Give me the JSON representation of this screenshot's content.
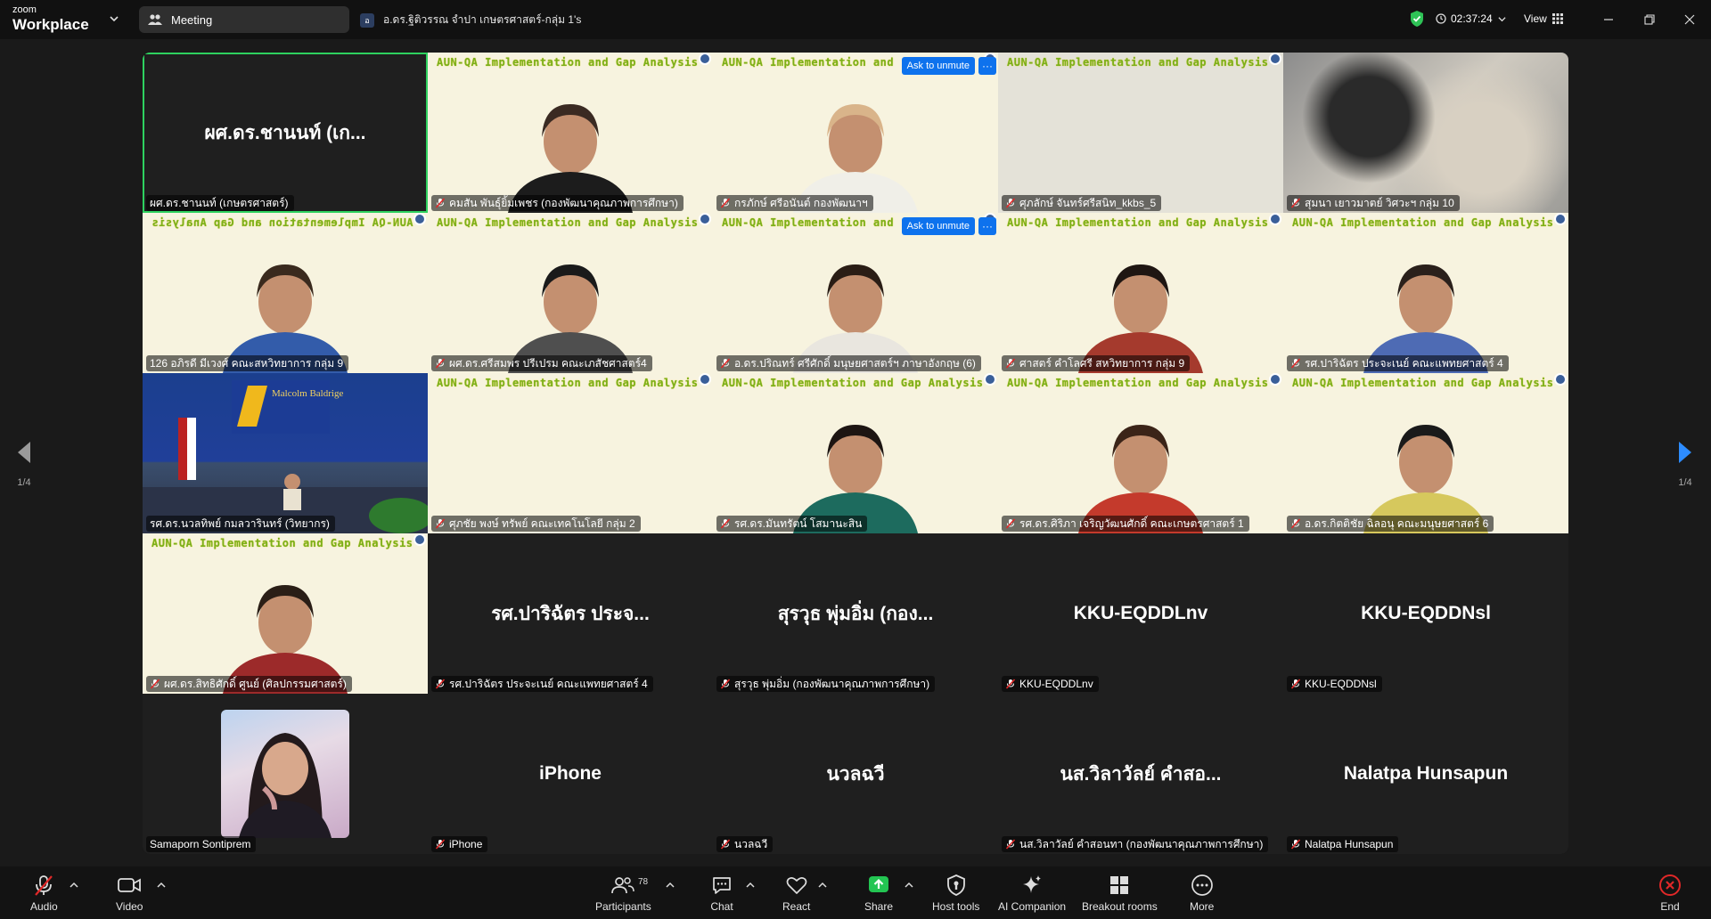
{
  "app": {
    "brand_top": "zoom",
    "brand_bottom": "Workplace",
    "meeting_label": "Meeting",
    "tab_avatar": "อ",
    "tab_title": "อ.ดร.ฐิติวรรณ จำปา เกษตรศาสตร์-กลุ่ม 1's",
    "timer": "02:37:24",
    "view_label": "View"
  },
  "banner_text": "AUN-QA Implementation and Gap Analysis",
  "banner_text_short": "AUN-QA Implementation and",
  "unmute_label": "Ask to unmute",
  "tiles": [
    {
      "style": "black",
      "bigname": "ผศ.ดร.ชานนท์ (เก...",
      "name": "ผศ.ดร.ชานนท์ (เกษตรศาสตร์)",
      "muted": false,
      "active": true
    },
    {
      "style": "cream",
      "banner": "full",
      "name": "คมสัน พันธุ์ยิ้มเพชร (กองพัฒนาคุณภาพการศึกษา)",
      "muted": true,
      "person": "man-dark"
    },
    {
      "style": "cream",
      "banner": "short",
      "unmute": true,
      "name": "กรภักษ์ ศรีอนันต์ กองพัฒนาฯ",
      "muted": true,
      "person": "woman-light"
    },
    {
      "style": "gray",
      "banner": "full",
      "name": "ศุภลักษ์ จันทร์ศรีสนิท_kkbs_5",
      "muted": true
    },
    {
      "style": "blurry",
      "name": "สุมนา เยาวมาตย์ วิศวะฯ กลุ่ม 10",
      "muted": true
    },
    {
      "style": "cream",
      "banner": "flip",
      "name": "126 อภิรดี มีเวงศ์ คณะสหวิทยาการ กลุ่ม 9",
      "muted": false,
      "person": "woman-blue"
    },
    {
      "style": "cream",
      "banner": "full",
      "name": "ผศ.ดร.ศรีสมพร ปรีเปรม คณะเภสัชศาสตร์4",
      "muted": true,
      "person": "woman-glasses"
    },
    {
      "style": "cream",
      "banner": "short",
      "unmute": true,
      "name": "อ.ดร.ปริณทร์ ศรีศักดิ์ มนุษยศาสตร์ฯ ภาษาอังกฤษ (6)",
      "muted": true,
      "person": "man-small"
    },
    {
      "style": "cream",
      "banner": "full",
      "name": "ศาสตร์ คำโลศรี สหวิทยาการ กลุ่ม 9",
      "muted": true,
      "person": "man-red"
    },
    {
      "style": "cream",
      "banner": "full",
      "name": "รศ.ปาริฉัตร ประจะเนย์ คณะแพทยศาสตร์ 4",
      "muted": true,
      "person": "woman-dark"
    },
    {
      "style": "photo",
      "name": "รศ.ดร.นวลทิพย์ กมลวารินทร์ (วิทยากร)",
      "muted": false,
      "stage": "Malcolm Baldrige"
    },
    {
      "style": "cream",
      "banner": "full",
      "name": "ศุภชัย พงษ์ ทรัพย์ คณะเทคโนโลยี กลุ่ม 2",
      "muted": true
    },
    {
      "style": "cream",
      "banner": "full",
      "name": "รศ.ดร.มันทรัตน์ โสมานะสิน",
      "muted": true,
      "person": "woman-green"
    },
    {
      "style": "cream",
      "banner": "full",
      "name": "รศ.ดร.ศิริภา เจริญวัฒนศักดิ์ คณะเกษตรศาสตร์ 1",
      "muted": true,
      "person": "woman-red"
    },
    {
      "style": "cream",
      "banner": "full",
      "name": "อ.ดร.กิตติชัย ฉิลอนุ คณะมนุษยศาสตร์ 6",
      "muted": true,
      "person": "man-yellow"
    },
    {
      "style": "cream",
      "banner": "full",
      "name": "ผศ.ดร.สิทธิศักดิ์ ศูนย์ (ศิลปกรรมศาสตร์)",
      "muted": true,
      "person": "man-red2"
    },
    {
      "style": "black",
      "bigname": "รศ.ปาริฉัตร ประจ...",
      "name": "รศ.ปาริฉัตร ประจะเนย์ คณะแพทยศาสตร์ 4",
      "muted": true
    },
    {
      "style": "black",
      "bigname": "สุรวุธ พุ่มอิ่ม (กอง...",
      "name": "สุรวุธ พุ่มอิ่ม (กองพัฒนาคุณภาพการศึกษา)",
      "muted": true
    },
    {
      "style": "black",
      "bigname": "KKU-EQDDLnv",
      "name": "KKU-EQDDLnv",
      "muted": true
    },
    {
      "style": "black",
      "bigname": "KKU-EQDDNsl",
      "name": "KKU-EQDDNsl",
      "muted": true
    },
    {
      "style": "black",
      "avatar": true,
      "name": "Samaporn Sontiprem",
      "muted": false
    },
    {
      "style": "black",
      "bigname": "iPhone",
      "name": "iPhone",
      "muted": true
    },
    {
      "style": "black",
      "bigname": "นวลฉวี",
      "name": "นวลฉวี",
      "muted": true
    },
    {
      "style": "black",
      "bigname": "นส.วิลาวัลย์ คำสอ...",
      "name": "นส.วิลาวัลย์ คำสอนทา (กองพัฒนาคุณภาพการศึกษา)",
      "muted": true
    },
    {
      "style": "black",
      "bigname": "Nalatpa Hunsapun",
      "name": "Nalatpa Hunsapun",
      "muted": true
    }
  ],
  "pager": {
    "left": "1/4",
    "right": "1/4"
  },
  "toolbar": {
    "audio": "Audio",
    "video": "Video",
    "participants": "Participants",
    "participants_count": "78",
    "chat": "Chat",
    "react": "React",
    "share": "Share",
    "host_tools": "Host tools",
    "ai_companion": "AI Companion",
    "breakout": "Breakout rooms",
    "more": "More",
    "end": "End"
  },
  "colors": {
    "accent": "#0e72ed",
    "active_border": "#2ed15f",
    "muted_red": "#e02828",
    "share_green": "#23c552",
    "end_red": "#e02828",
    "banner_green": "#79b01c"
  }
}
